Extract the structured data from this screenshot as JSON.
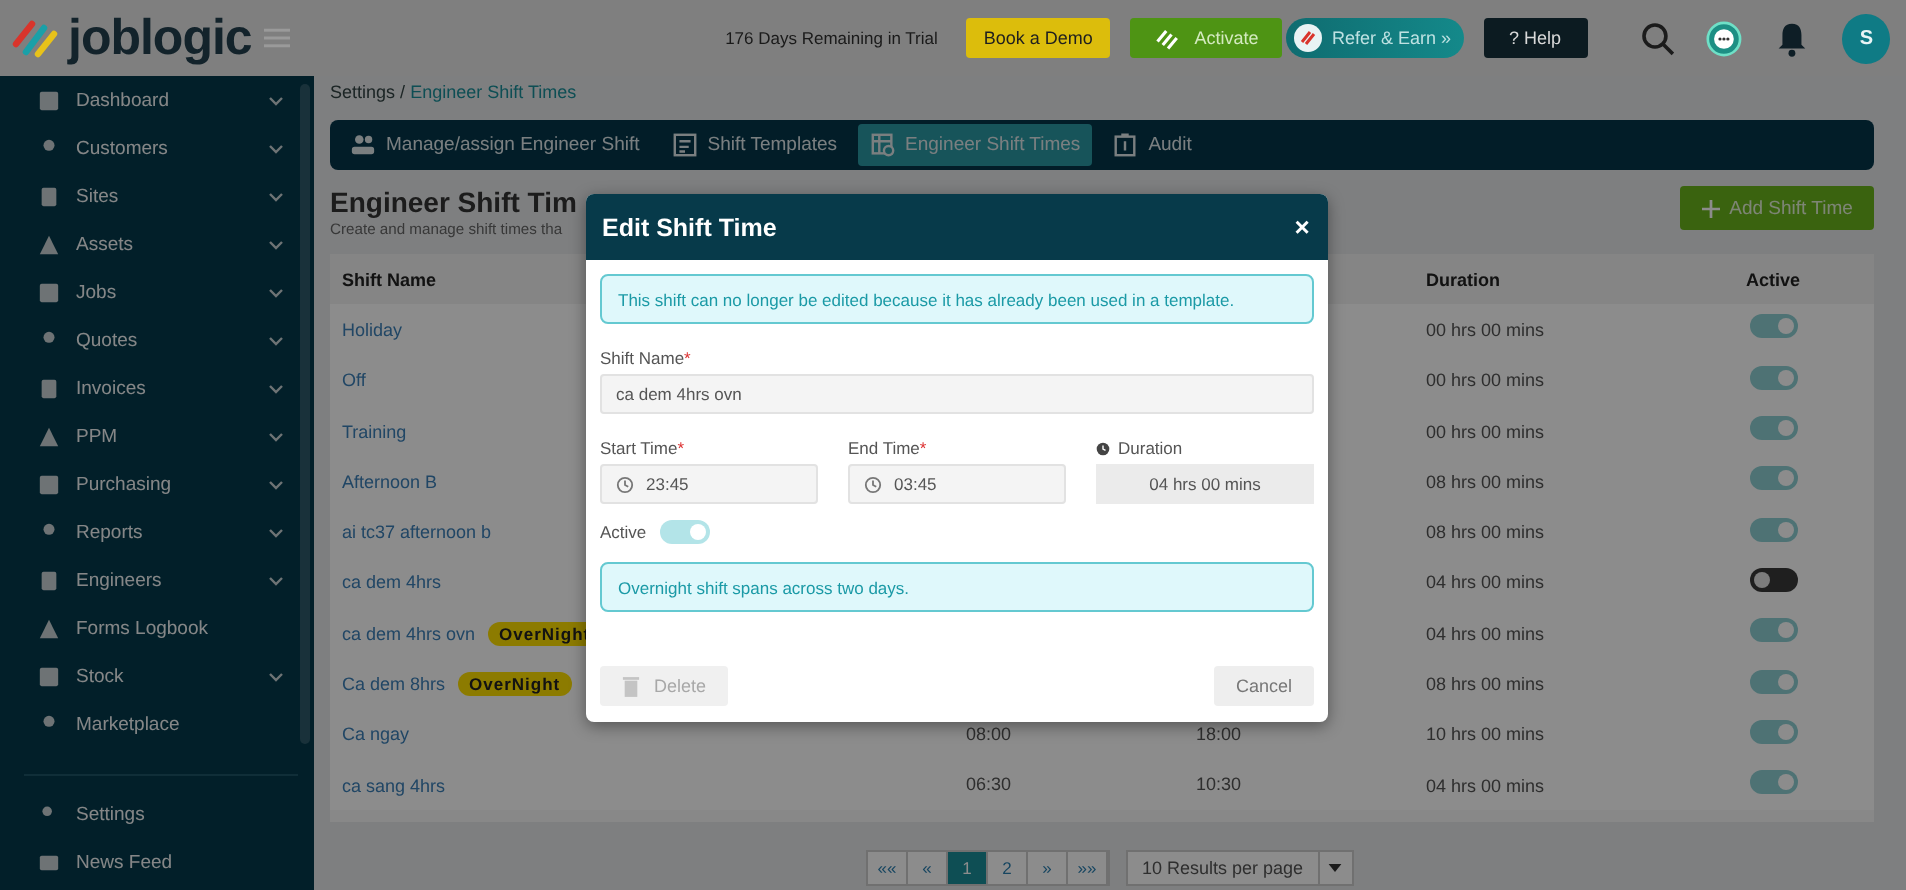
{
  "header": {
    "brand": "joblogic",
    "trial": "176 Days Remaining in Trial",
    "buttons": [
      {
        "label": "Book a Demo",
        "kind": "demo"
      },
      {
        "label": "Activate",
        "kind": "activate"
      },
      {
        "label": "Refer & Earn »",
        "kind": "refer"
      },
      {
        "label": "? Help",
        "kind": "help"
      }
    ],
    "avatar": "S"
  },
  "sidebar": {
    "items": [
      {
        "label": "Dashboard",
        "expandable": true
      },
      {
        "label": "Customers",
        "expandable": true
      },
      {
        "label": "Sites",
        "expandable": true
      },
      {
        "label": "Assets",
        "expandable": true
      },
      {
        "label": "Jobs",
        "expandable": true
      },
      {
        "label": "Quotes",
        "expandable": true
      },
      {
        "label": "Invoices",
        "expandable": true
      },
      {
        "label": "PPM",
        "expandable": true
      },
      {
        "label": "Purchasing",
        "expandable": true
      },
      {
        "label": "Reports",
        "expandable": true
      },
      {
        "label": "Engineers",
        "expandable": true
      },
      {
        "label": "Forms Logbook",
        "expandable": false
      },
      {
        "label": "Stock",
        "expandable": true
      },
      {
        "label": "Marketplace",
        "expandable": false
      }
    ],
    "footer_items": [
      {
        "label": "Settings"
      },
      {
        "label": "News Feed"
      }
    ]
  },
  "breadcrumb": {
    "parent": "Settings",
    "separator": "/",
    "current": "Engineer Shift Times"
  },
  "tabs": [
    {
      "label": "Manage/assign Engineer Shift",
      "selected": false
    },
    {
      "label": "Shift Templates",
      "selected": false
    },
    {
      "label": "Engineer Shift Times",
      "selected": true
    },
    {
      "label": "Audit",
      "selected": false
    }
  ],
  "page": {
    "title": "Engineer Shift Tim",
    "subtitle": "Create and manage shift times tha",
    "add_button": "Add Shift Time"
  },
  "table": {
    "columns": {
      "name": "Shift Name",
      "duration": "Duration",
      "active": "Active"
    },
    "rows": [
      {
        "name": "Holiday",
        "duration": "00 hrs 00 mins",
        "active": true
      },
      {
        "name": "Off",
        "duration": "00 hrs 00 mins",
        "active": true
      },
      {
        "name": "Training",
        "duration": "00 hrs 00 mins",
        "active": true
      },
      {
        "name": "Afternoon B",
        "duration": "08 hrs 00 mins",
        "active": true
      },
      {
        "name": "ai tc37 afternoon b",
        "duration": "08 hrs 00 mins",
        "active": true
      },
      {
        "name": "ca dem 4hrs",
        "duration": "04 hrs 00 mins",
        "active": false
      },
      {
        "name": "ca dem 4hrs ovn",
        "badge": "OverNight",
        "duration": "04 hrs 00 mins",
        "active": true
      },
      {
        "name": "Ca dem 8hrs",
        "badge": "OverNight",
        "duration": "08 hrs 00 mins",
        "active": true
      },
      {
        "name": "Ca ngay",
        "start": "08:00",
        "end": "18:00",
        "duration": "10 hrs 00 mins",
        "active": true
      },
      {
        "name": "ca sang 4hrs",
        "start": "06:30",
        "end": "10:30",
        "duration": "04 hrs 00 mins",
        "active": true
      }
    ]
  },
  "pagination": {
    "pages": [
      {
        "label": "««",
        "selected": false
      },
      {
        "label": "«",
        "selected": false
      },
      {
        "label": "1",
        "selected": true
      },
      {
        "label": "2",
        "selected": false
      },
      {
        "label": "»",
        "selected": false
      },
      {
        "label": "»»",
        "selected": false
      }
    ],
    "per_page": "10 Results per page"
  },
  "modal": {
    "title": "Edit Shift Time",
    "close": "×",
    "notice": "This shift can no longer be edited because it has already been used in a template.",
    "shift_name": {
      "label": "Shift Name",
      "mark": "*",
      "value": "ca dem 4hrs ovn"
    },
    "start_time": {
      "label": "Start Time",
      "mark": "*",
      "value": "23:45"
    },
    "end_time": {
      "label": "End Time",
      "mark": "*",
      "value": "03:45"
    },
    "duration": {
      "label": "Duration",
      "value": "04 hrs 00 mins"
    },
    "active": {
      "label": "Active",
      "on": true
    },
    "info": "Overnight shift spans across two days.",
    "delete": {
      "label": "Delete",
      "disabled": true
    },
    "cancel": "Cancel"
  }
}
